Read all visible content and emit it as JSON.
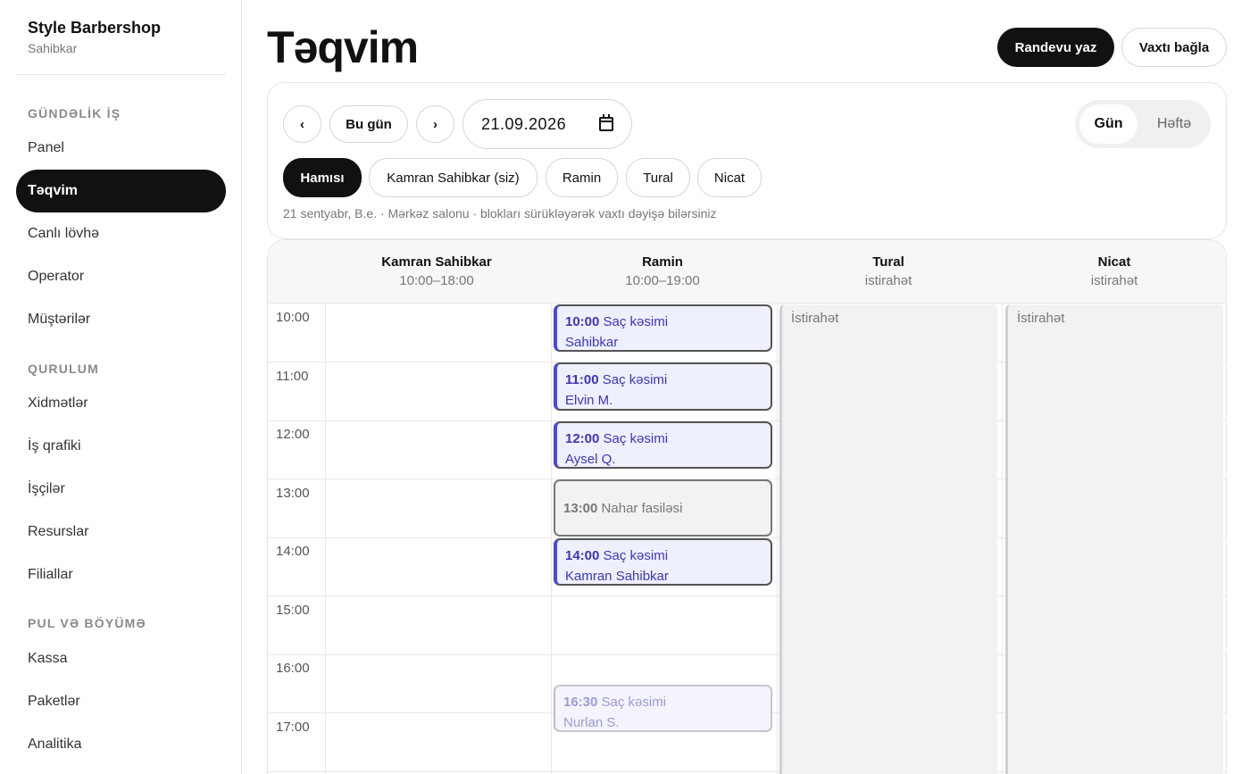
{
  "sidebar": {
    "brand_name": "Style Barbershop",
    "brand_role": "Sahibkar",
    "sections": [
      {
        "title": "GÜNDƏLİK İŞ",
        "items": [
          "Panel",
          "Təqvim",
          "Canlı lövhə",
          "Operator",
          "Müştərilər"
        ]
      },
      {
        "title": "QURULUM",
        "items": [
          "Xidmətlər",
          "İş qrafiki",
          "İşçilər",
          "Resurslar",
          "Filiallar"
        ]
      },
      {
        "title": "PUL VƏ BÖYÜMƏ",
        "items": [
          "Kassa",
          "Paketlər",
          "Analitika"
        ]
      }
    ],
    "active_item": "Təqvim"
  },
  "header": {
    "title": "Təqvim",
    "primary_button": "Randevu yaz",
    "secondary_button": "Vaxtı bağla"
  },
  "toolbar": {
    "prev_label": "‹",
    "today_label": "Bu gün",
    "next_label": "›",
    "date_value": "21.09.2026",
    "views": [
      "Gün",
      "Həftə"
    ],
    "active_view": "Gün",
    "filters": [
      "Hamısı",
      "Kamran Sahibkar (siz)",
      "Ramin",
      "Tural",
      "Nicat"
    ],
    "active_filter": "Hamısı",
    "note": "21 sentyabr, B.e. · Mərkəz salonu · blokları sürükləyərək vaxtı dəyişə bilərsiniz"
  },
  "calendar": {
    "columns": [
      {
        "name": "Kamran Sahibkar",
        "hours": "10:00–18:00"
      },
      {
        "name": "Ramin",
        "hours": "10:00–19:00"
      },
      {
        "name": "Tural",
        "hours": "istirahət"
      },
      {
        "name": "Nicat",
        "hours": "istirahət"
      }
    ],
    "hours": [
      "10:00",
      "11:00",
      "12:00",
      "13:00",
      "14:00",
      "15:00",
      "16:00",
      "17:00"
    ],
    "off_label": "İstirahət",
    "appointments": [
      {
        "time": "10:00",
        "service": "Saç kəsimi",
        "client": "Sahibkar"
      },
      {
        "time": "11:00",
        "service": "Saç kəsimi",
        "client": "Elvin M."
      },
      {
        "time": "12:00",
        "service": "Saç kəsimi",
        "client": "Aysel Q."
      },
      {
        "time": "13:00",
        "service": "Nahar fasiləsi",
        "client": ""
      },
      {
        "time": "14:00",
        "service": "Saç kəsimi",
        "client": "Kamran Sahibkar"
      },
      {
        "time": "16:30",
        "service": "Saç kəsimi",
        "client": "Nurlan S."
      }
    ]
  }
}
